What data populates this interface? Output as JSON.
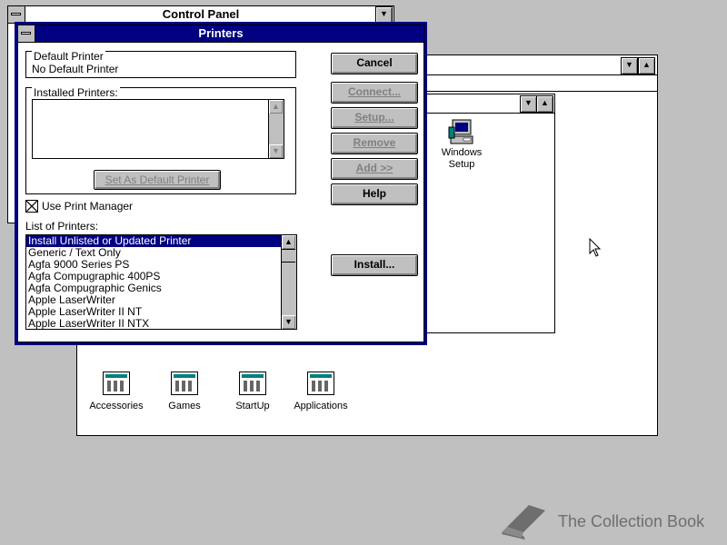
{
  "control_panel": {
    "title": "Control Panel"
  },
  "program_manager": {
    "groups": [
      {
        "label": "Accessories"
      },
      {
        "label": "Games"
      },
      {
        "label": "StartUp"
      },
      {
        "label": "Applications"
      }
    ]
  },
  "main_group": {
    "icons": [
      {
        "label": "Windows Setup"
      }
    ]
  },
  "printers_dialog": {
    "title": "Printers",
    "default_printer": {
      "label": "Default Printer",
      "value": "No Default Printer"
    },
    "installed_printers": {
      "label": "Installed Printers:",
      "items": []
    },
    "set_default_label": "Set As Default Printer",
    "use_print_manager": {
      "label": "Use Print Manager",
      "checked": true
    },
    "list_label": "List of Printers:",
    "printers": [
      "Install Unlisted or Updated Printer",
      "Generic / Text Only",
      "Agfa 9000 Series PS",
      "Agfa Compugraphic 400PS",
      "Agfa Compugraphic Genics",
      "Apple LaserWriter",
      "Apple LaserWriter II NT",
      "Apple LaserWriter II NTX"
    ],
    "selected_index": 0,
    "buttons": {
      "cancel": "Cancel",
      "connect": "Connect...",
      "setup": "Setup...",
      "remove": "Remove",
      "add": "Add >>",
      "help": "Help",
      "install": "Install..."
    }
  },
  "watermark": {
    "text": "The Collection Book",
    "icon": "book-icon"
  },
  "icons": {
    "scroll_up": "▲",
    "scroll_down": "▼",
    "minimize": "▼",
    "maximize": "▲",
    "close_box": "☒"
  }
}
